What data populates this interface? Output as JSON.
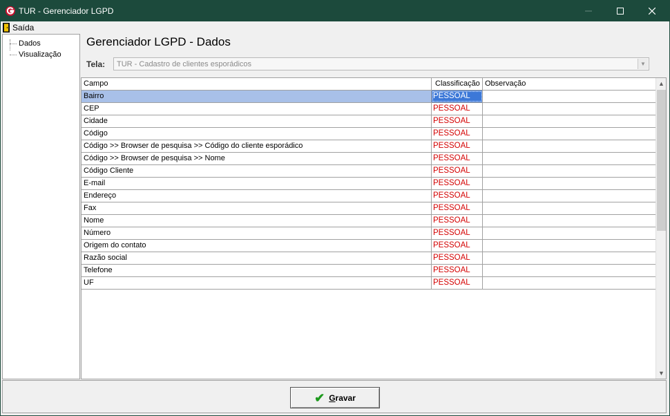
{
  "window": {
    "title": "TUR - Gerenciador LGPD"
  },
  "menu": {
    "exit_label": "Saída"
  },
  "tree": {
    "items": [
      {
        "label": "Dados"
      },
      {
        "label": "Visualização"
      }
    ]
  },
  "main": {
    "page_title": "Gerenciador LGPD - Dados",
    "tela_label": "Tela:",
    "tela_value": "TUR - Cadastro de clientes esporádicos"
  },
  "grid": {
    "columns": [
      "Campo",
      "Classificação",
      "Observação"
    ],
    "rows": [
      {
        "campo": "Bairro",
        "classificacao": "PESSOAL",
        "observacao": "",
        "selected": true
      },
      {
        "campo": "CEP",
        "classificacao": "PESSOAL",
        "observacao": ""
      },
      {
        "campo": "Cidade",
        "classificacao": "PESSOAL",
        "observacao": ""
      },
      {
        "campo": "Código",
        "classificacao": "PESSOAL",
        "observacao": ""
      },
      {
        "campo": "Código >> Browser de pesquisa >> Código do cliente esporádico",
        "classificacao": "PESSOAL",
        "observacao": ""
      },
      {
        "campo": "Código >> Browser de pesquisa >> Nome",
        "classificacao": "PESSOAL",
        "observacao": ""
      },
      {
        "campo": "Código Cliente",
        "classificacao": "PESSOAL",
        "observacao": ""
      },
      {
        "campo": "E-mail",
        "classificacao": "PESSOAL",
        "observacao": ""
      },
      {
        "campo": "Endereço",
        "classificacao": "PESSOAL",
        "observacao": ""
      },
      {
        "campo": "Fax",
        "classificacao": "PESSOAL",
        "observacao": ""
      },
      {
        "campo": "Nome",
        "classificacao": "PESSOAL",
        "observacao": ""
      },
      {
        "campo": "Número",
        "classificacao": "PESSOAL",
        "observacao": ""
      },
      {
        "campo": "Origem do contato",
        "classificacao": "PESSOAL",
        "observacao": ""
      },
      {
        "campo": "Razão social",
        "classificacao": "PESSOAL",
        "observacao": ""
      },
      {
        "campo": "Telefone",
        "classificacao": "PESSOAL",
        "observacao": ""
      },
      {
        "campo": "UF",
        "classificacao": "PESSOAL",
        "observacao": ""
      }
    ]
  },
  "footer": {
    "save_label": "Gravar"
  },
  "colors": {
    "titlebar": "#1c4a3c",
    "classification_text": "#d40000",
    "selection": "#3c78d8",
    "save_check": "#1e9a1e"
  }
}
